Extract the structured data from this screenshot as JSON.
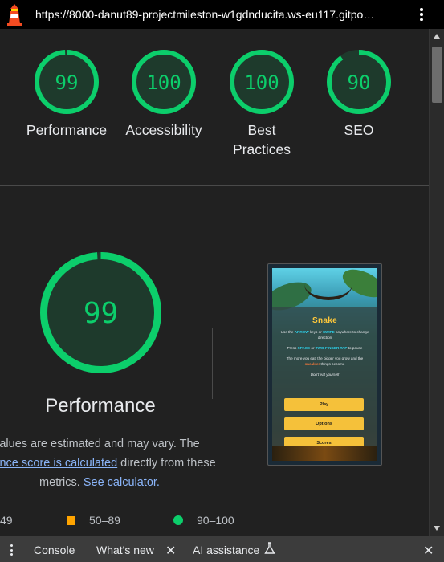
{
  "browser": {
    "url": "https://8000-danut89-projectmileston-w1gdnducita.ws-eu117.gitpo…",
    "menu_icon": "kebab-menu-icon",
    "logo_icon": "lighthouse-icon"
  },
  "summary_gauges": [
    {
      "label": "Performance",
      "score": "99",
      "value": 99
    },
    {
      "label": "Accessibility",
      "score": "100",
      "value": 100
    },
    {
      "label": "Best Practices",
      "line1": "Best",
      "line2": "Practices",
      "score": "100",
      "value": 100
    },
    {
      "label": "SEO",
      "score": "90",
      "value": 90
    }
  ],
  "performance": {
    "score": "99",
    "value": 99,
    "title": "Performance",
    "desc_line1": "alues are estimated and may vary. The",
    "desc_link1": "mance score is calculated",
    "desc_line2_rest": " directly from these",
    "desc_line3_prefix": "metrics. ",
    "desc_link2": "See calculator."
  },
  "legend": {
    "fail": "49",
    "average": "50–89",
    "pass": "90–100"
  },
  "screenshot": {
    "game_title": "Snake",
    "line1_a": "Use the ",
    "line1_b": "ARROW",
    "line1_c": " keys or ",
    "line1_d": "SWIPE",
    "line1_e": " anywhere to change direction",
    "line2_a": "Press ",
    "line2_b": "SPACE",
    "line2_c": " or ",
    "line2_d": "TWO-FINGER TAP",
    "line2_e": " to pause",
    "line3_a": "The more you eat, the bigger you grow and the ",
    "line3_b": "sneakier",
    "line3_c": " things become",
    "line4": "Don't eat yourself",
    "buttons": [
      "Play",
      "Options",
      "Scores"
    ]
  },
  "drawer": {
    "tabs": [
      "Console",
      "What's new",
      "AI assistance"
    ],
    "menu_icon": "vertical-dots-icon",
    "ai_icon": "flask-icon"
  },
  "colors": {
    "pass": "#0cce6b",
    "average": "#ffa400",
    "link": "#8ab4f8",
    "background": "#212121"
  }
}
